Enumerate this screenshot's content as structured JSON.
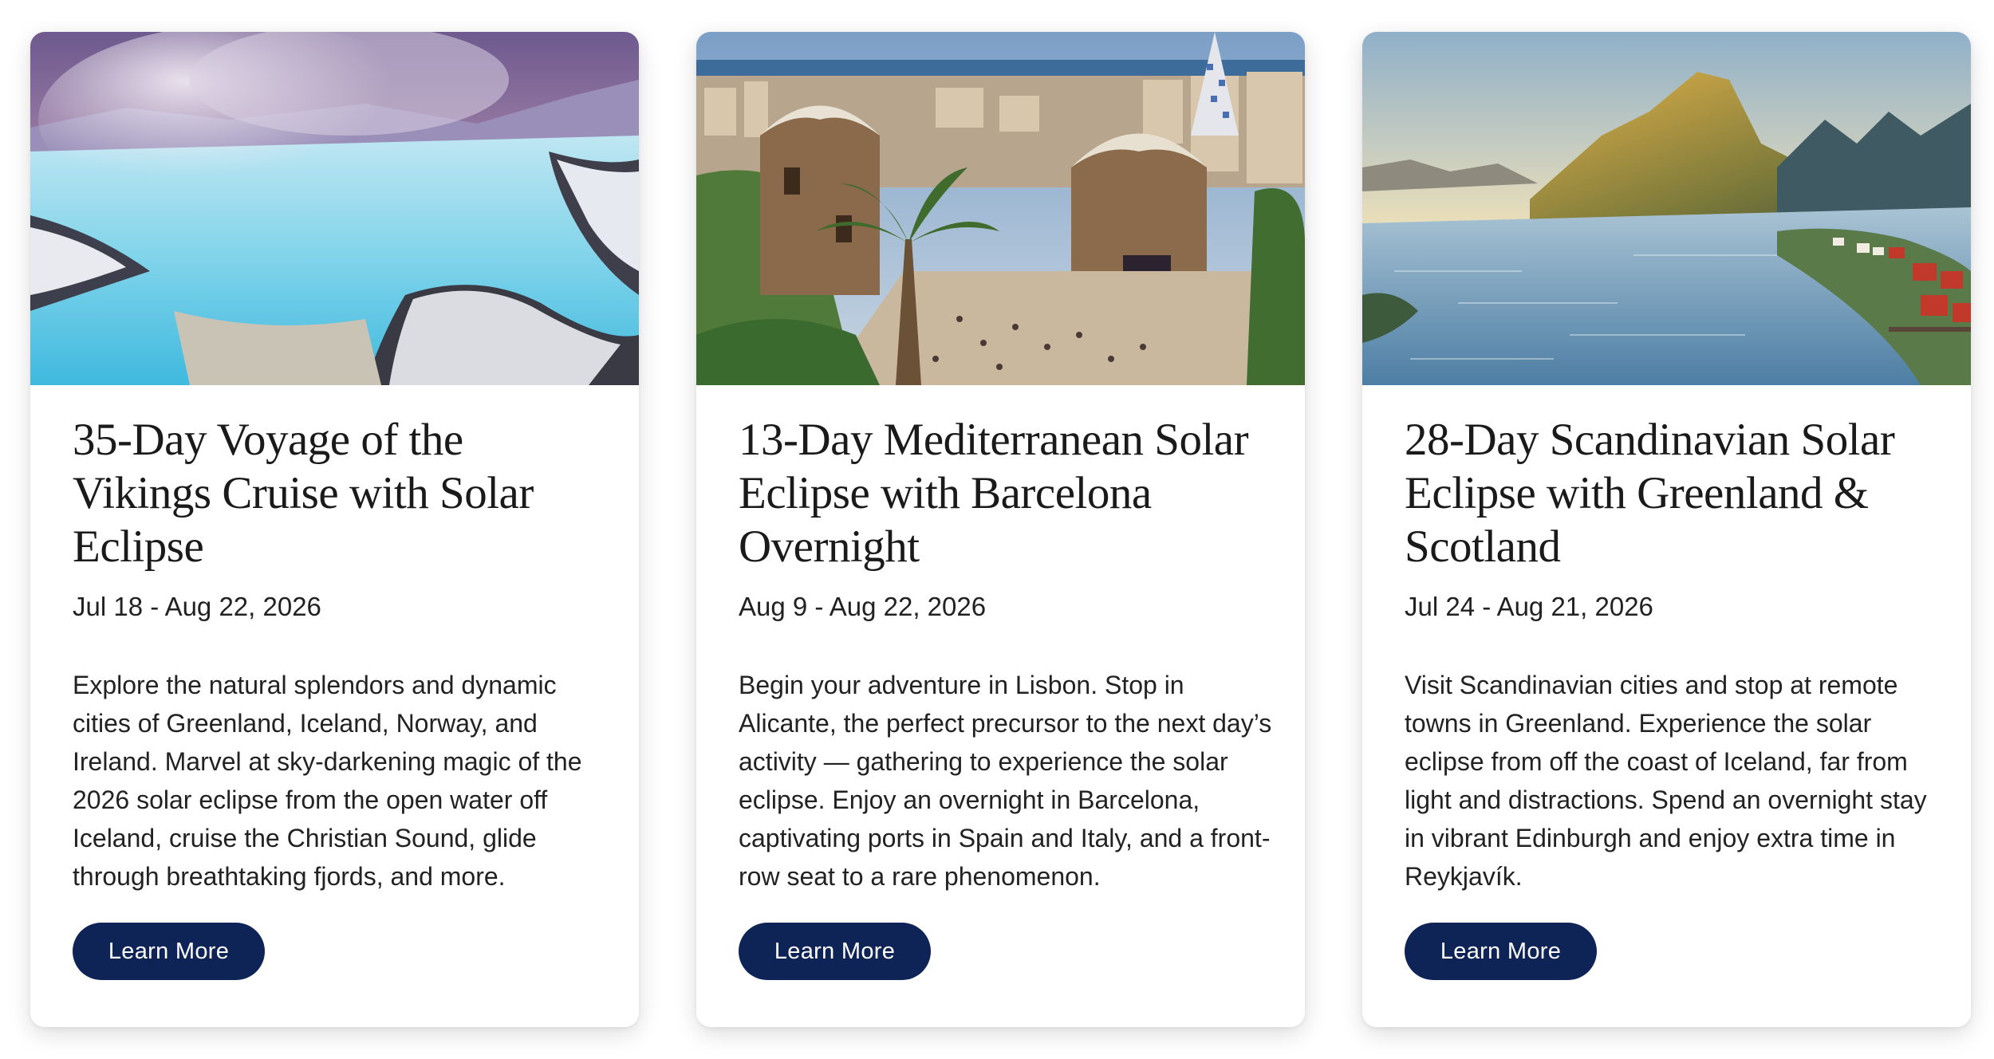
{
  "cards": [
    {
      "image_alt": "Blue Lagoon hot spring in snowy lava field",
      "title": "35-Day Voyage of the Vikings Cruise with Solar Eclipse",
      "dates": "Jul 18 - Aug 22, 2026",
      "description": "Explore the natural splendors and dynamic cities of Greenland, Iceland, Norway, and Ireland. Marvel at sky-darkening magic of the 2026 solar eclipse from the open water off Iceland, cruise the Christian Sound, glide through breathtaking fjords, and more.",
      "button_label": "Learn More"
    },
    {
      "image_alt": "Park Güell gatehouses overlooking Barcelona",
      "title": "13-Day Mediterranean Solar Eclipse with Barcelona Overnight",
      "dates": "Aug 9 - Aug 22, 2026",
      "description": "Begin your adventure in Lisbon. Stop in Alicante, the perfect precursor to the next day’s activity — gathering to experience the solar eclipse. Enjoy an overnight in Barcelona, captivating ports in Spain and Italy, and a front-row seat to a rare phenomenon.",
      "button_label": "Learn More"
    },
    {
      "image_alt": "Fjord village beneath mountain peaks at sunset",
      "title": "28-Day Scandinavian Solar Eclipse with Greenland & Scotland",
      "dates": "Jul 24 - Aug 21, 2026",
      "description": "Visit Scandinavian cities and stop at remote towns in Greenland. Experience the solar eclipse from off the coast of Iceland, far from light and distractions. Spend an overnight stay in vibrant Edinburgh and enjoy extra time in Reykjavík.",
      "button_label": "Learn More"
    }
  ],
  "colors": {
    "button_bg": "#0f2456",
    "button_text": "#ffffff",
    "title_text": "#1a1a1a",
    "body_text": "#222222"
  }
}
